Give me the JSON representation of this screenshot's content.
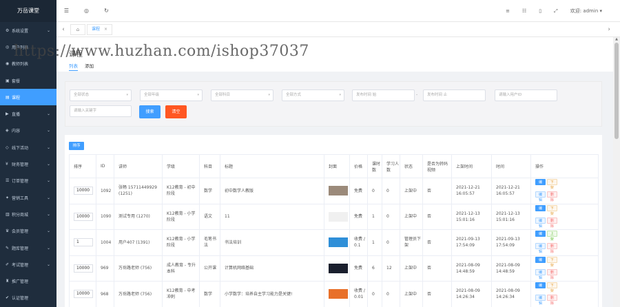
{
  "sidebar": {
    "brand": "万岳课堂",
    "items": [
      {
        "icon": "gear-icon",
        "glyph": "⚙",
        "label": "系统设置",
        "chevron": true
      },
      {
        "icon": "user-icon",
        "glyph": "◎",
        "label": "用户列表",
        "chevron": false
      },
      {
        "icon": "teacher-icon",
        "glyph": "◉",
        "label": "教师列表",
        "chevron": false
      },
      {
        "icon": "package-icon",
        "glyph": "▣",
        "label": "套餐",
        "chevron": false
      },
      {
        "icon": "course-icon",
        "glyph": "▤",
        "label": "课程",
        "chevron": false,
        "active": true
      },
      {
        "icon": "live-icon",
        "glyph": "▶",
        "label": "直播",
        "chevron": true
      },
      {
        "icon": "content-icon",
        "glyph": "◈",
        "label": "内容",
        "chevron": true
      },
      {
        "icon": "offline-icon",
        "glyph": "◇",
        "label": "线下活动",
        "chevron": true
      },
      {
        "icon": "finance-icon",
        "glyph": "¥",
        "label": "财务管理",
        "chevron": true
      },
      {
        "icon": "order-icon",
        "glyph": "☰",
        "label": "订单管理",
        "chevron": true
      },
      {
        "icon": "marketing-icon",
        "glyph": "✦",
        "label": "营销工具",
        "chevron": true
      },
      {
        "icon": "mall-icon",
        "glyph": "▥",
        "label": "积分商城",
        "chevron": true
      },
      {
        "icon": "member-icon",
        "glyph": "♛",
        "label": "会员管理",
        "chevron": true
      },
      {
        "icon": "question-bank-icon",
        "glyph": "✎",
        "label": "题库管理",
        "chevron": true
      },
      {
        "icon": "exam-icon",
        "glyph": "✐",
        "label": "考试管理",
        "chevron": true
      },
      {
        "icon": "promotion-icon",
        "glyph": "♜",
        "label": "推广管理",
        "chevron": false
      },
      {
        "icon": "certification-icon",
        "glyph": "✔",
        "label": "认证管理",
        "chevron": false
      }
    ]
  },
  "topbar": {
    "left_icons": [
      "menu-toggle-icon",
      "globe-icon",
      "refresh-icon"
    ],
    "left_glyphs": [
      "☰",
      "◎",
      "↻"
    ],
    "right_icons": [
      "list-icon",
      "filter-icon",
      "document-icon",
      "fullscreen-icon"
    ],
    "right_glyphs": [
      "≡",
      "☷",
      "▯",
      "⤢"
    ],
    "welcome": "欢迎: admin ▾"
  },
  "tabs": {
    "home_glyph": "⌂",
    "active_tab": "课程",
    "close_glyph": "×",
    "left_arrow": "‹",
    "right_arrow": "›"
  },
  "page": {
    "title": "课程",
    "subtabs": [
      "列表",
      "添加"
    ]
  },
  "watermark": "https://www.huzhan.com/ishop37037",
  "filters": {
    "selects": [
      "全部状态",
      "全部年级",
      "全部科目",
      "全部方式"
    ],
    "date_start": "发布时间 始",
    "date_sep": "-",
    "date_end": "发布时间 止",
    "lecturer_placeholder": "请输入用户ID",
    "keyword_placeholder": "请输入关键字",
    "search_label": "搜索",
    "clear_label": "清空",
    "dd_glyph": "▾"
  },
  "table": {
    "sort_button": "排序",
    "headers": [
      "排序",
      "ID",
      "讲师",
      "学级",
      "科目",
      "标题",
      "封面",
      "价格",
      "课时数",
      "学习人数",
      "状态",
      "是否为转码视频",
      "上架时间",
      "时间",
      "操作"
    ],
    "rows": [
      {
        "sort": "10000",
        "id": "1092",
        "lecturer": "张畅 15711449929 (1251)",
        "grade": "K12教育 - 初中阶段",
        "subject": "数学",
        "title": "初中数学人教版",
        "price": "免费",
        "lessons": "0",
        "students": "0",
        "status": "上架中",
        "transcode": "否",
        "listed": "2021-12-21 16:05:57",
        "time": "2021-12-21 16:05:57",
        "ops": [
          "编辑",
          "下架",
          "编辑",
          "删除"
        ],
        "cover": "#9b8a7a"
      },
      {
        "sort": "10000",
        "id": "1090",
        "lecturer": "测试专用 (1270)",
        "grade": "K12教育 - 小学阶段",
        "subject": "语文",
        "title": "11",
        "price": "免费",
        "lessons": "1",
        "students": "0",
        "status": "上架中",
        "transcode": "否",
        "listed": "2021-12-13 15:01:16",
        "time": "2021-12-13 15:01:16",
        "ops": [
          "编辑",
          "下架",
          "编辑",
          "删除"
        ],
        "cover": "#f0f0f0"
      },
      {
        "sort": "1",
        "id": "1004",
        "lecturer": "用户407 (1391)",
        "grade": "K12教育 - 小学阶段",
        "subject": "毛笔书法",
        "title": "书法培训",
        "price": "收费 / 0.1",
        "lessons": "1",
        "students": "0",
        "status": "管理员下架",
        "transcode": "否",
        "listed": "2021-09-13 17:54:09",
        "time": "2021-09-13 17:54:09",
        "ops": [
          "编辑",
          "上架",
          "编辑",
          "删除"
        ],
        "cover": "#2f8fd8"
      },
      {
        "sort": "10000",
        "id": "969",
        "lecturer": "万岳路老师 (756)",
        "grade": "成人教育 - 专升本科",
        "subject": "公开课",
        "title": "计算机网络基础",
        "price": "免费",
        "lessons": "6",
        "students": "12",
        "status": "上架中",
        "transcode": "否",
        "listed": "2021-08-09 14:48:59",
        "time": "2021-08-09 14:48:59",
        "ops": [
          "编辑",
          "下架",
          "编辑",
          "删除"
        ],
        "cover": "#1a1f2e"
      },
      {
        "sort": "10000",
        "id": "968",
        "lecturer": "万岳路老师 (756)",
        "grade": "K12教育 - 中考冲刺",
        "subject": "数学",
        "title": "小学数学：培养自主学习能力是关键!",
        "price": "收费 / 0.01",
        "lessons": "0",
        "students": "0",
        "status": "上架中",
        "transcode": "否",
        "listed": "2021-08-09 14:26:34",
        "time": "2021-08-09 14:26:34",
        "ops": [
          "编辑",
          "下架",
          "编辑",
          "删除"
        ],
        "cover": "#e8702a"
      }
    ]
  },
  "colors": {
    "accent": "#409eff",
    "danger_button": "#ff5722",
    "sidebar_bg": "#1f2d3d"
  }
}
